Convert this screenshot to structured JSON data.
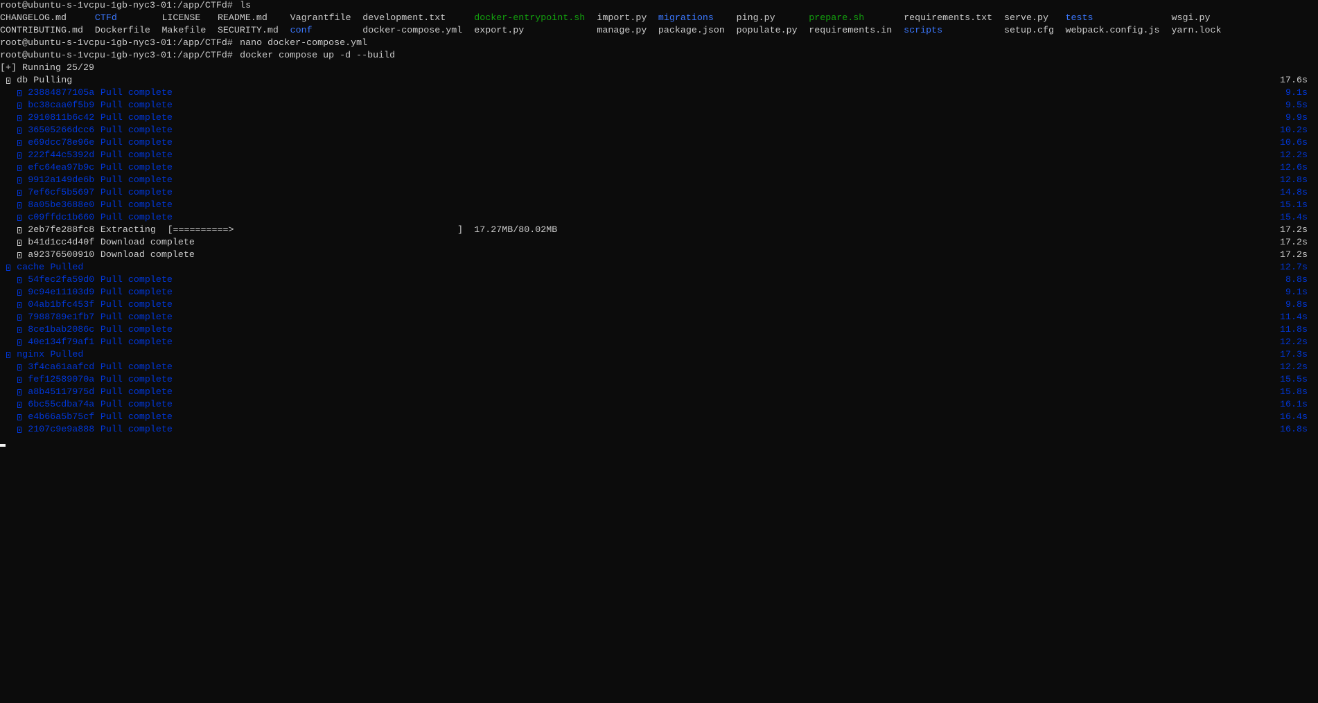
{
  "terminal": {
    "prompt": "root@ubuntu-s-1vcpu-1gb-nyc3-01:/app/CTFd#",
    "commands": [
      "ls",
      "nano docker-compose.yml",
      "docker compose up -d --build"
    ],
    "ls_rows": [
      [
        {
          "name": "CHANGELOG.md",
          "type": "file"
        },
        {
          "name": "CTFd",
          "type": "dir"
        },
        {
          "name": "LICENSE",
          "type": "file"
        },
        {
          "name": "README.md",
          "type": "file"
        },
        {
          "name": "Vagrantfile",
          "type": "file"
        },
        {
          "name": "development.txt",
          "type": "file"
        },
        {
          "name": "docker-entrypoint.sh",
          "type": "exec"
        },
        {
          "name": "import.py",
          "type": "file"
        },
        {
          "name": "migrations",
          "type": "dir"
        },
        {
          "name": "ping.py",
          "type": "file"
        },
        {
          "name": "prepare.sh",
          "type": "exec"
        },
        {
          "name": "requirements.txt",
          "type": "file"
        },
        {
          "name": "serve.py",
          "type": "file"
        },
        {
          "name": "tests",
          "type": "dir"
        },
        {
          "name": "wsgi.py",
          "type": "file"
        }
      ],
      [
        {
          "name": "CONTRIBUTING.md",
          "type": "file"
        },
        {
          "name": "Dockerfile",
          "type": "file"
        },
        {
          "name": "Makefile",
          "type": "file"
        },
        {
          "name": "SECURITY.md",
          "type": "file"
        },
        {
          "name": "conf",
          "type": "dir"
        },
        {
          "name": "docker-compose.yml",
          "type": "file"
        },
        {
          "name": "export.py",
          "type": "file"
        },
        {
          "name": "manage.py",
          "type": "file"
        },
        {
          "name": "package.json",
          "type": "file"
        },
        {
          "name": "populate.py",
          "type": "file"
        },
        {
          "name": "requirements.in",
          "type": "file"
        },
        {
          "name": "scripts",
          "type": "dir"
        },
        {
          "name": "setup.cfg",
          "type": "file"
        },
        {
          "name": "webpack.config.js",
          "type": "file"
        },
        {
          "name": "yarn.lock",
          "type": "file"
        }
      ]
    ],
    "status": "[+] Running 25/29",
    "services": [
      {
        "name": "db",
        "state": "Pulling",
        "time": "17.6s",
        "done": false,
        "layers": [
          {
            "id": "23884877105a",
            "status": "Pull complete",
            "time": "9.1s",
            "done": true
          },
          {
            "id": "bc38caa0f5b9",
            "status": "Pull complete",
            "time": "9.5s",
            "done": true
          },
          {
            "id": "2910811b6c42",
            "status": "Pull complete",
            "time": "9.9s",
            "done": true
          },
          {
            "id": "36505266dcc6",
            "status": "Pull complete",
            "time": "10.2s",
            "done": true
          },
          {
            "id": "e69dcc78e96e",
            "status": "Pull complete",
            "time": "10.6s",
            "done": true
          },
          {
            "id": "222f44c5392d",
            "status": "Pull complete",
            "time": "12.2s",
            "done": true
          },
          {
            "id": "efc64ea97b9c",
            "status": "Pull complete",
            "time": "12.6s",
            "done": true
          },
          {
            "id": "9912a149de6b",
            "status": "Pull complete",
            "time": "12.8s",
            "done": true
          },
          {
            "id": "7ef6cf5b5697",
            "status": "Pull complete",
            "time": "14.8s",
            "done": true
          },
          {
            "id": "8a05be3688e0",
            "status": "Pull complete",
            "time": "15.1s",
            "done": true
          },
          {
            "id": "c09ffdc1b660",
            "status": "Pull complete",
            "time": "15.4s",
            "done": true
          },
          {
            "id": "2eb7fe288fc8",
            "status": "Extracting",
            "time": "17.2s",
            "done": false,
            "progress": {
              "bar": "[==========>",
              "bar_end": "]",
              "amount": "17.27MB/80.02MB",
              "fraction": 0.216
            }
          },
          {
            "id": "b41d1cc4d40f",
            "status": "Download complete",
            "time": "17.2s",
            "done": false
          },
          {
            "id": "a92376500910",
            "status": "Download complete",
            "time": "17.2s",
            "done": false
          }
        ]
      },
      {
        "name": "cache",
        "state": "Pulled",
        "time": "12.7s",
        "done": true,
        "layers": [
          {
            "id": "54fec2fa59d0",
            "status": "Pull complete",
            "time": "8.8s",
            "done": true
          },
          {
            "id": "9c94e11103d9",
            "status": "Pull complete",
            "time": "9.1s",
            "done": true
          },
          {
            "id": "04ab1bfc453f",
            "status": "Pull complete",
            "time": "9.8s",
            "done": true
          },
          {
            "id": "7988789e1fb7",
            "status": "Pull complete",
            "time": "11.4s",
            "done": true
          },
          {
            "id": "8ce1bab2086c",
            "status": "Pull complete",
            "time": "11.8s",
            "done": true
          },
          {
            "id": "40e134f79af1",
            "status": "Pull complete",
            "time": "12.2s",
            "done": true
          }
        ]
      },
      {
        "name": "nginx",
        "state": "Pulled",
        "time": "17.3s",
        "done": true,
        "layers": [
          {
            "id": "3f4ca61aafcd",
            "status": "Pull complete",
            "time": "12.2s",
            "done": true
          },
          {
            "id": "fef12589070a",
            "status": "Pull complete",
            "time": "15.5s",
            "done": true
          },
          {
            "id": "a8b45117975d",
            "status": "Pull complete",
            "time": "15.8s",
            "done": true
          },
          {
            "id": "6bc55cdba74a",
            "status": "Pull complete",
            "time": "16.1s",
            "done": true
          },
          {
            "id": "e4b66a5b75cf",
            "status": "Pull complete",
            "time": "16.4s",
            "done": true
          },
          {
            "id": "2107c9e9a888",
            "status": "Pull complete",
            "time": "16.8s",
            "done": true
          }
        ]
      }
    ],
    "status_icon": "spinner-glyph-icon"
  },
  "colors": {
    "background": "#0c0c0c",
    "foreground": "#cccccc",
    "done": "#0037da",
    "dir": "#3b78ff",
    "exec": "#13a10e",
    "cursor": "#f2f2f2"
  }
}
